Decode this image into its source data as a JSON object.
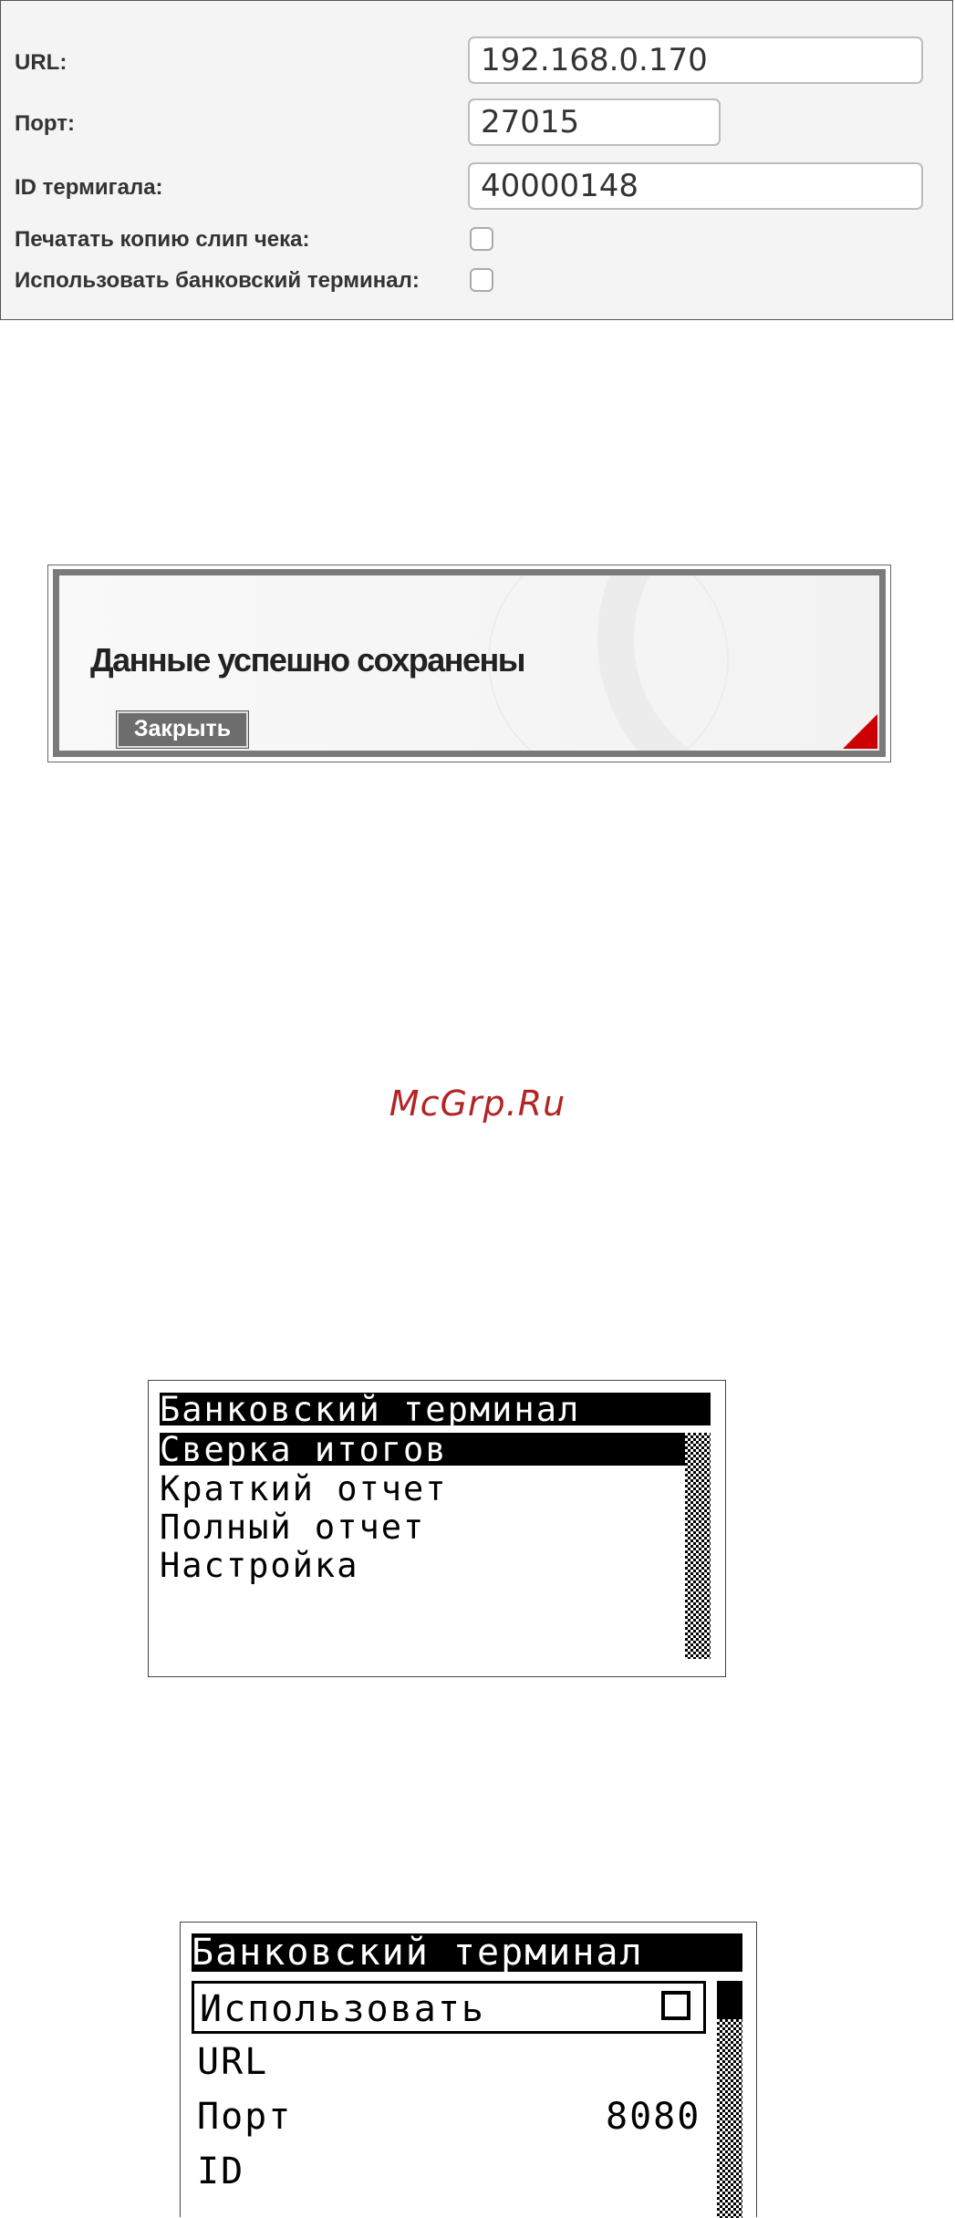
{
  "settings_form": {
    "fields": [
      {
        "label": "URL:",
        "value": "192.168.0.170"
      },
      {
        "label": "Порт:",
        "value": "27015"
      },
      {
        "label": "ID термигала:",
        "value": "40000148"
      }
    ],
    "print_copy_label": "Печатать копию слип чека:",
    "print_copy_checked": false,
    "use_terminal_label": "Использовать банковский терминал:",
    "use_terminal_checked": false
  },
  "dialog": {
    "message": "Данные успешно сохранены",
    "close_label": "Закрыть",
    "corner_color": "#cc0000"
  },
  "watermark": "McGrp.Ru",
  "lcd_menu": {
    "title": "Банковский терминал",
    "items": [
      "Сверка итогов",
      "Краткий отчет",
      "Полный отчет",
      "Настройка"
    ],
    "selected_index": 0
  },
  "lcd_settings": {
    "title": "Банковский терминал",
    "use_label": "Использовать",
    "url_label": "URL",
    "port_label": "Порт",
    "port_value": "8080",
    "id_label": "ID"
  }
}
